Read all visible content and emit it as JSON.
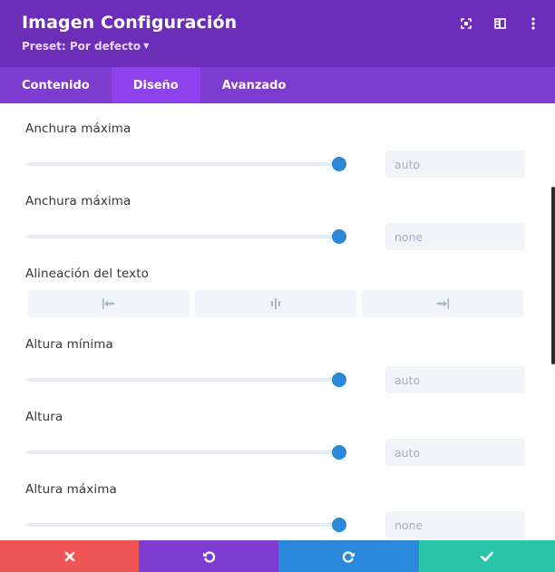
{
  "header": {
    "title": "Imagen Configuración",
    "preset": "Preset: Por defecto",
    "icons": [
      "focus-icon",
      "sidebar-toggle-icon",
      "more-options-icon"
    ]
  },
  "tabs": [
    {
      "label": "Contenido",
      "active": false
    },
    {
      "label": "Diseño",
      "active": true
    },
    {
      "label": "Avanzado",
      "active": false
    }
  ],
  "fields": {
    "max_width_1": {
      "label": "Anchura máxima",
      "value": "auto",
      "slider_level": 1.0
    },
    "max_width_2": {
      "label": "Anchura máxima",
      "value": "none",
      "slider_level": 1.0
    },
    "text_align": {
      "label": "Alineación del texto",
      "options": [
        "left",
        "center",
        "right"
      ]
    },
    "min_height": {
      "label": "Altura mínima",
      "value": "auto",
      "slider_level": 1.0
    },
    "height": {
      "label": "Altura",
      "value": "auto",
      "slider_level": 1.0
    },
    "max_height": {
      "label": "Altura máxima",
      "value": "none",
      "slider_level": 1.0
    }
  },
  "footer": {
    "buttons": [
      "cancel",
      "undo",
      "redo",
      "save"
    ]
  },
  "colors": {
    "header": "#6c2eb9",
    "tab_bar": "#7e3bd0",
    "tab_active": "#8f42ec",
    "slider": "#2b87da",
    "cancel": "#ef5555",
    "undo": "#7d3bcf",
    "redo": "#2b87da",
    "save": "#29c4a9"
  }
}
